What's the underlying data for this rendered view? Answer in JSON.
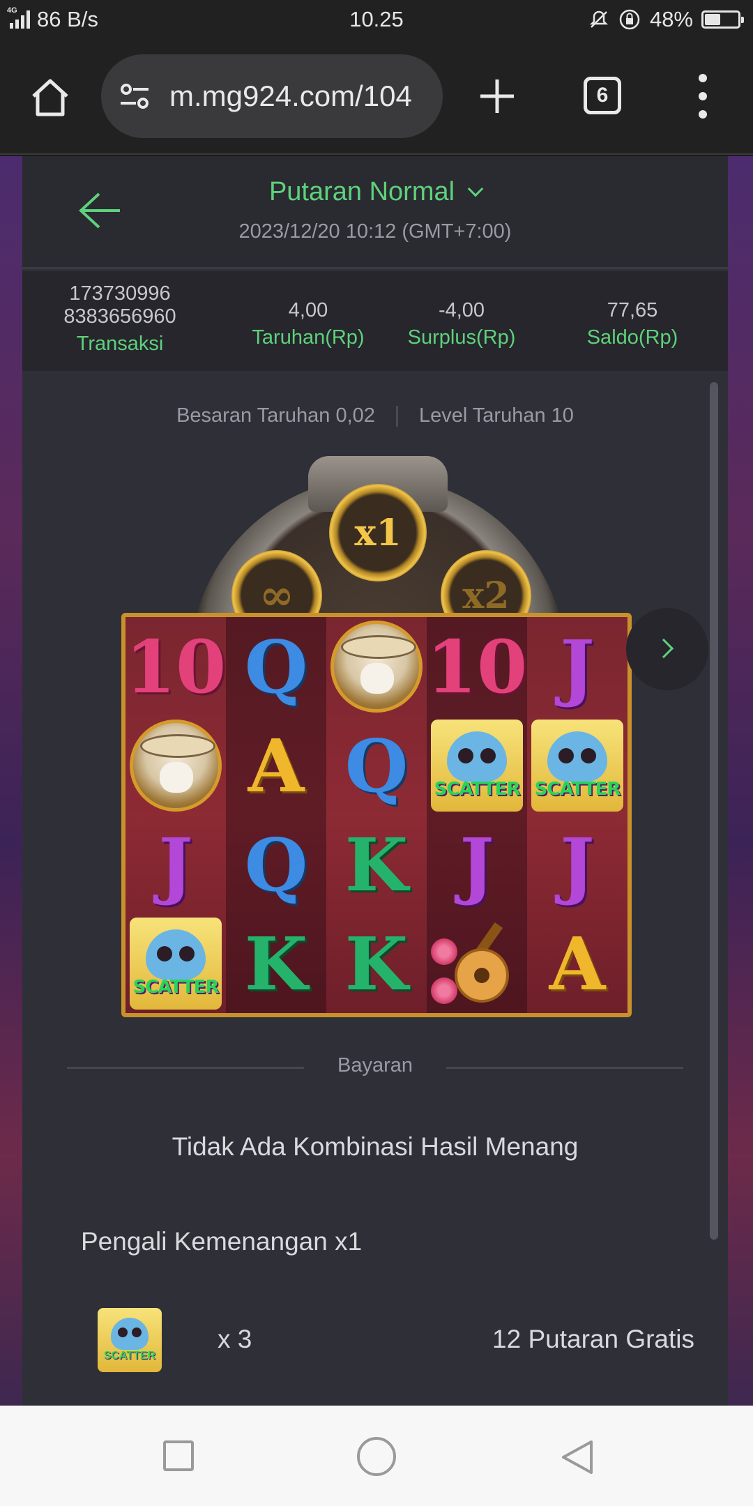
{
  "status_bar": {
    "network": "4G",
    "speed": "86 B/s",
    "time": "10.25",
    "battery": "48%",
    "battery_level": 0.48
  },
  "browser": {
    "url": "m.mg924.com/104",
    "tab_count": "6"
  },
  "header": {
    "title": "Putaran Normal",
    "datetime": "2023/12/20 10:12 (GMT+7:00)"
  },
  "stats": {
    "transaction_id_line1": "173730996",
    "transaction_id_line2": "8383656960",
    "transaction_label": "Transaksi",
    "bet_value": "4,00",
    "bet_label": "Taruhan(Rp)",
    "surplus_value": "-4,00",
    "surplus_label": "Surplus(Rp)",
    "balance_value": "77,65",
    "balance_label": "Saldo(Rp)"
  },
  "bet_info": {
    "bet_size": "Besaran Taruhan 0,02",
    "bet_level": "Level Taruhan 10"
  },
  "multiplier_wheel": {
    "center": "x1",
    "left": "∞",
    "right": "x2"
  },
  "reels": [
    [
      "10",
      "bandit",
      "J",
      "scatter"
    ],
    [
      "Q",
      "A",
      "Q",
      "K"
    ],
    [
      "bandit",
      "Q",
      "K",
      "K"
    ],
    [
      "10",
      "scatter",
      "J",
      "guitar"
    ],
    [
      "J",
      "scatter",
      "J",
      "A"
    ]
  ],
  "scatter_text": "SCATTER",
  "payout": {
    "section_label": "Bayaran",
    "no_win": "Tidak Ada Kombinasi Hasil Menang",
    "multiplier": "Pengali Kemenangan x1",
    "reward_icon_text": "SCATTER",
    "reward_count": "x 3",
    "reward_text": "12 Putaran Gratis"
  },
  "colors": {
    "accent_green": "#5ed17c",
    "panel": "#2f2f37",
    "header_bg": "#2a2a31"
  }
}
